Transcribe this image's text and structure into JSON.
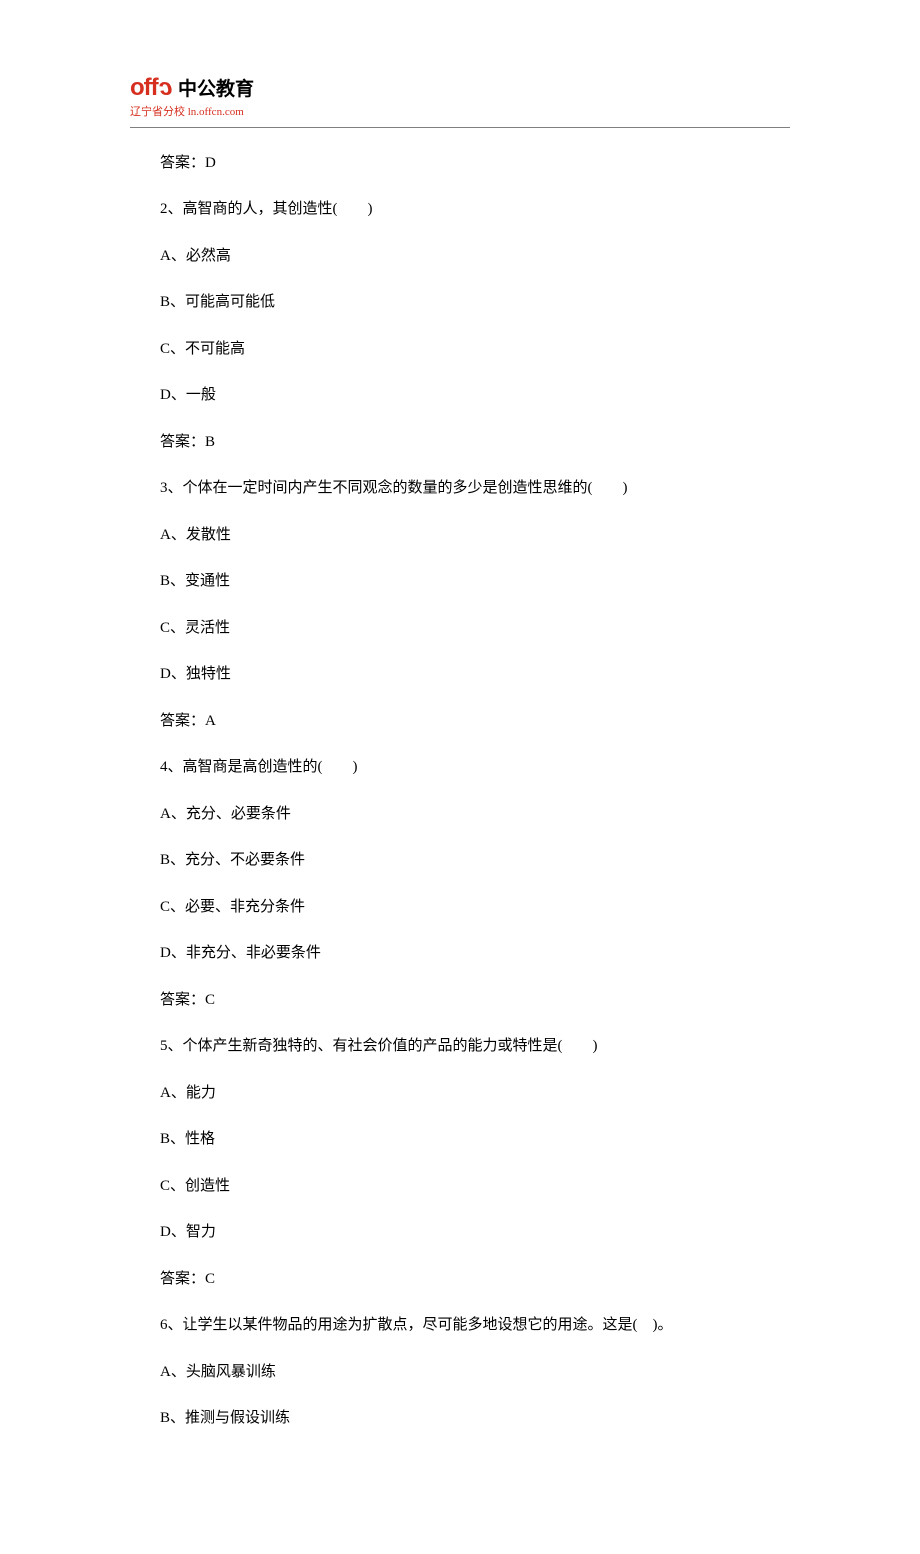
{
  "logo": {
    "off": "off",
    "cn": "c",
    "brand": "中公教育",
    "subsite": "辽宁省分校 ln.offcn.com"
  },
  "lines": [
    "答案：D",
    "2、高智商的人，其创造性(　　)",
    "A、必然高",
    "B、可能高可能低",
    "C、不可能高",
    "D、一般",
    "答案：B",
    "3、个体在一定时间内产生不同观念的数量的多少是创造性思维的(　　)",
    "A、发散性",
    "B、变通性",
    "C、灵活性",
    "D、独特性",
    "答案：A",
    "4、高智商是高创造性的(　　)",
    "A、充分、必要条件",
    "B、充分、不必要条件",
    "C、必要、非充分条件",
    "D、非充分、非必要条件",
    "答案：C",
    "5、个体产生新奇独特的、有社会价值的产品的能力或特性是(　　)",
    "A、能力",
    "B、性格",
    "C、创造性",
    "D、智力",
    "答案：C",
    "6、让学生以某件物品的用途为扩散点，尽可能多地设想它的用途。这是(　)。",
    "A、头脑风暴训练",
    "B、推测与假设训练"
  ]
}
